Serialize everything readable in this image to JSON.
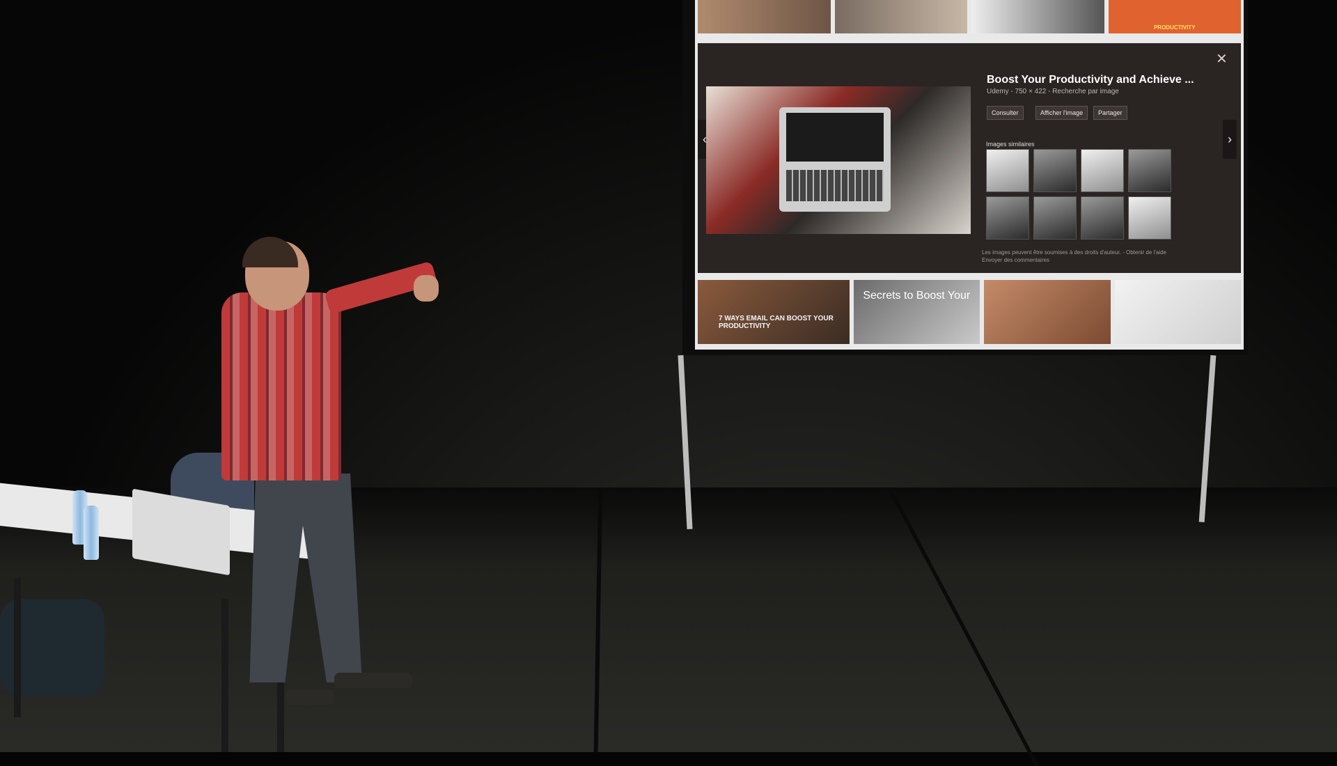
{
  "screen": {
    "panel": {
      "title": "Boost Your Productivity and Achieve ...",
      "meta": "Udemy - 750 × 422 - Recherche par image",
      "buttons": {
        "consult": "Consulter",
        "view_image": "Afficher l'image",
        "share": "Partager"
      },
      "similar_label": "Images similaires",
      "footer_line1": "Les images peuvent être soumises à des droits d'auteur. - Obtenir de l'aide",
      "footer_line2": "Envoyer des commentaires",
      "close_glyph": "✕",
      "nav_prev": "‹",
      "nav_next": "›"
    },
    "bottom_strip": {
      "thumb1_text": "7 WAYS EMAIL CAN BOOST YOUR PRODUCTIVITY",
      "thumb2_text": "Secrets to Boost Your"
    },
    "top_strip": {
      "thumb4_text": "PRODUCTIVITY"
    }
  }
}
